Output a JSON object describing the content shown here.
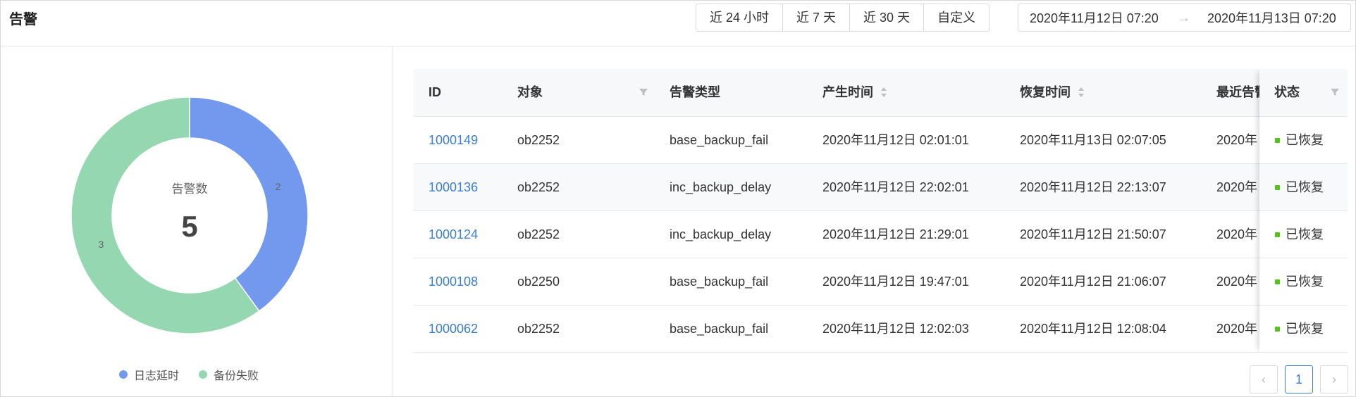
{
  "panel": {
    "title": "告警"
  },
  "time_ranges": [
    "近 24 小时",
    "近 7 天",
    "近 30 天",
    "自定义"
  ],
  "date_range": {
    "start": "2020年11月12日 07:20",
    "separator": "→",
    "end": "2020年11月13日 07:20"
  },
  "chart_data": {
    "type": "pie",
    "center_label": "告警数",
    "center_value": "5",
    "categories": [
      "日志延时",
      "备份失败"
    ],
    "values": [
      2,
      3
    ],
    "colors": [
      "#7399EE",
      "#95D7B1"
    ],
    "legend_position": "bottom"
  },
  "table": {
    "columns": [
      "ID",
      "对象",
      "告警类型",
      "产生时间",
      "恢复时间",
      "最近告警",
      "状态"
    ],
    "rows": [
      {
        "id": "1000149",
        "object": "ob2252",
        "type": "base_backup_fail",
        "created": "2020年11月12日 02:01:01",
        "recovered": "2020年11月13日 02:07:05",
        "recent": "2020年",
        "status": "已恢复"
      },
      {
        "id": "1000136",
        "object": "ob2252",
        "type": "inc_backup_delay",
        "created": "2020年11月12日 22:02:01",
        "recovered": "2020年11月12日 22:13:07",
        "recent": "2020年",
        "status": "已恢复"
      },
      {
        "id": "1000124",
        "object": "ob2252",
        "type": "inc_backup_delay",
        "created": "2020年11月12日 21:29:01",
        "recovered": "2020年11月12日 21:50:07",
        "recent": "2020年",
        "status": "已恢复"
      },
      {
        "id": "1000108",
        "object": "ob2250",
        "type": "base_backup_fail",
        "created": "2020年11月12日 19:47:01",
        "recovered": "2020年11月12日 21:06:07",
        "recent": "2020年",
        "status": "已恢复"
      },
      {
        "id": "1000062",
        "object": "ob2252",
        "type": "base_backup_fail",
        "created": "2020年11月12日 12:02:03",
        "recovered": "2020年11月12日 12:08:04",
        "recent": "2020年",
        "status": "已恢复"
      }
    ]
  },
  "pagination": {
    "prev": "‹",
    "current": "1",
    "next": "›"
  },
  "colors": {
    "link": "#3a7fd5",
    "status_ok": "#52c41a"
  }
}
